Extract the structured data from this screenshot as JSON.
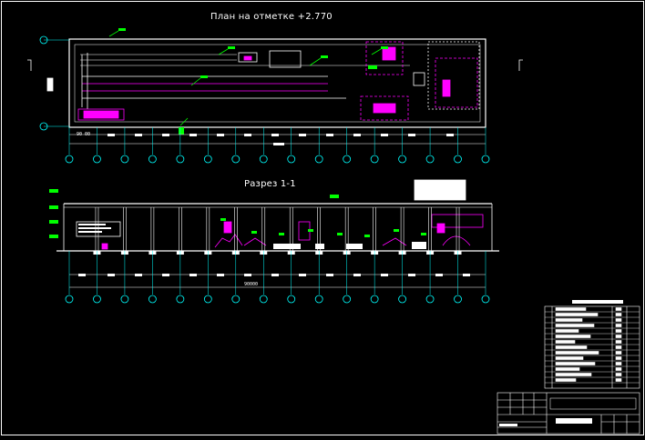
{
  "drawing": {
    "plan_title": "План на отметке +2.770",
    "section_title": "Разрез 1-1",
    "plan_dimension_label": "90 00",
    "section_dimension_label": "90000"
  },
  "colors": {
    "background": "#000000",
    "lines": "#ffffff",
    "axis": "#00ffff",
    "equipment": "#ff00ff",
    "labels": "#00ff00"
  },
  "axes": {
    "count": 16,
    "marker_icon": "circle-axis-marker"
  }
}
